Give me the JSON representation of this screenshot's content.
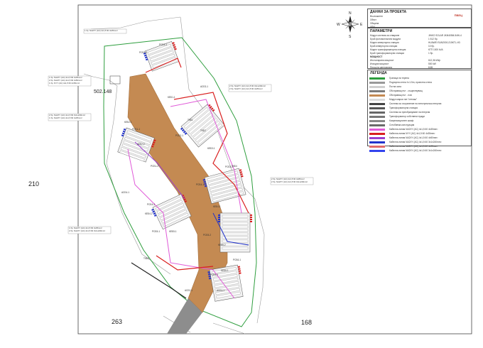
{
  "map": {
    "parcel_labels": [
      "502.148",
      "210",
      "263",
      "168"
    ],
    "callouts": [
      "1 бр. NA2XY (AC) 4x1,5 60 4x35mm²",
      "1 бр. NA2XY (AC) 4x1,5 60 4x35mm²\n2 бр. NA2XY (AC) 4x1,5 60 4x50mm²\n1 бр. NYY (AC) 4x1,5 60 4x35mm²",
      "2 бр. NA2XY (AC) 4x1,5 60 3x1x240mm²\n2 бр. NA2XY (AC) 4x1,5 60 4x35mm²",
      "2 бр. NA2XY (AC) 4x1,5 60 3x1x240mm²\n1 бр. NA2XY (AC) 4x1,5 60 4x35mm²",
      "2 бр. NA2XY (AC) 4x1,5 60 4x95mm²\n2 бр. NA2XY (AC) 4x1,5 60 3x1x240mm²",
      "1 бр. NA2XY (AC) 4x1,5 60 4x35mm²\n2 бр. NA2XY (AC) 4x1,5 60 3x1x240mm²"
    ],
    "string_labels": [
      "РСБ2-3",
      "РСБ3-1",
      "КЕБ1-1",
      "КЕБ2-1",
      "КЕБ2-2",
      "РСБ2-1",
      "ТКБ1",
      "ТКБ2",
      "РСБ1-1",
      "РСБ1-2",
      "КЕБ3-1",
      "РСБ3-2",
      "РСБ4-1",
      "КЕБ4-1",
      "РСБ4-2",
      "КЕБ4-2",
      "РСБ5-1",
      "КЕБ5-1",
      "РСБ5-2",
      "КЕБ5-2",
      "РСБ6-1",
      "КЕБ6-1",
      "РСБ6-2",
      "АСБ1-1",
      "АСБ2-1",
      "АСБ3-1",
      "АСБ4-1",
      "ТКБ3",
      "ТКБ4"
    ],
    "block_labels": [
      "ТКБ",
      "1",
      "2",
      "3",
      "4",
      "5",
      "6"
    ]
  },
  "compass": {
    "n": "N",
    "s": "S",
    "e": "E",
    "w": "W"
  },
  "project_panel": {
    "title": "ДАННИ ЗА ПРОЕКТА",
    "rows": [
      "Възложител",
      "Обект",
      "Община",
      "УПИ ..."
    ],
    "logo": "ПВЕЦ"
  },
  "params_panel": {
    "title": "ПАРАМЕТРИ",
    "rows": [
      {
        "k": "Модул система за отваряне",
        "v": "JINKO SOLAR JKM405M-54HL4"
      },
      {
        "k": "Брой фотоволтаични модули",
        "v": "1 512 бр."
      },
      {
        "k": "Модел инверторна станция",
        "v": "HUAWEI SUN2000-215KTL-H3"
      },
      {
        "k": "Брой инверторни станции",
        "v": "10 бр."
      },
      {
        "k": "Модел трансформаторна станция",
        "v": "КТП 1000 kVA"
      },
      {
        "k": "Брой трансформаторни станции",
        "v": "1 бр."
      },
      {
        "k": "МОЩНОСТ",
        "v": ""
      },
      {
        "k": "Инсталирана мощност",
        "v": "612,36 kWp"
      },
      {
        "k": "Изходна мощност",
        "v": "500 kW"
      },
      {
        "k": "Площ на централата",
        "v": "8,65"
      }
    ]
  },
  "legend_panel": {
    "title": "ЛЕГЕНДА",
    "items": [
      {
        "label": "Граница на терена",
        "color": "#2e9e3e"
      },
      {
        "label": "Подпорна стена h=1.5m, проектна стена",
        "color": "#999999"
      },
      {
        "label": "Пътна зона",
        "color": "#cfcfcf"
      },
      {
        "label": "Обслужващ път - съществуващ",
        "color": "#7b7b7b"
      },
      {
        "label": "Обслужващ път - нов",
        "color": "#c48a52"
      },
      {
        "label": "Модул марка тип \"стелаж\"",
        "color": "#dadada"
      },
      {
        "label": "Система за съхранение на електрическа енергия",
        "color": "#444444"
      },
      {
        "label": "Трансформаторна станция",
        "color": "#555555"
      },
      {
        "label": "Система за преобразуване на енергия",
        "color": "#666666"
      },
      {
        "label": "Трансформатор собствени нужди",
        "color": "#777777"
      },
      {
        "label": "Комуникационен шкаф",
        "color": "#888888"
      },
      {
        "label": "Сглобяема конструкция",
        "color": "#6a6a6a"
      },
      {
        "label": "Кабелна линия NA2XY (AC) 4x1,5 60 4x35mm²",
        "color": "#e05ad8"
      },
      {
        "label": "Кабелна линия NYY (AC) 4x1,5 60 4x35mm²",
        "color": "#d91f1f"
      },
      {
        "label": "Кабелна линия NA2XY (AC) 4x1,5 60 4x50mm²",
        "color": "#9b3fcf"
      },
      {
        "label": "Кабелна линия NA2XY (AC) 4x1,5 60 3x1x240mm²",
        "color": "#2233cc"
      },
      {
        "label": "Кабелна линия NA2XY (AC) 4x1,5 60 4x95mm²",
        "color": "#e26b6b"
      },
      {
        "label": "Кабелна линия NA2XY (AC) 4x1,5 60 3x1x240mm²",
        "color": "#3344ee"
      }
    ]
  }
}
